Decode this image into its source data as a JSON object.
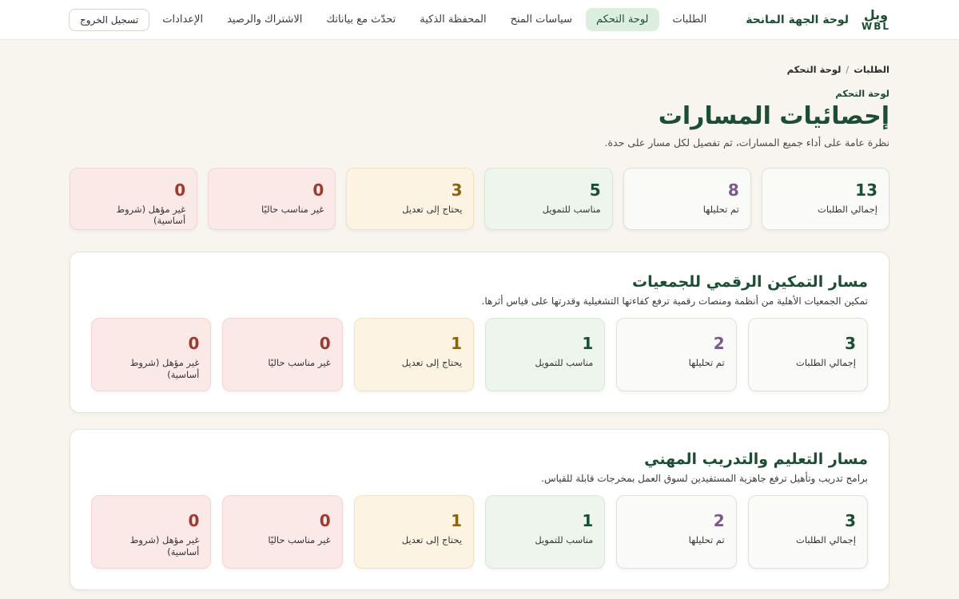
{
  "header": {
    "logo_ar": "وبل",
    "logo_en": "WBL",
    "brand_title": "لوحة الجهة المانحة",
    "nav": [
      {
        "label": "الطلبات",
        "active": false
      },
      {
        "label": "لوحة التحكم",
        "active": true
      },
      {
        "label": "سياسات المنح",
        "active": false
      },
      {
        "label": "المحفظة الذكية",
        "active": false
      },
      {
        "label": "تحدّث مع بياناتك",
        "active": false
      },
      {
        "label": "الاشتراك والرصيد",
        "active": false
      },
      {
        "label": "الإعدادات",
        "active": false
      }
    ],
    "logout_label": "تسجيل الخروج"
  },
  "breadcrumb": [
    "الطلبات",
    "لوحة التحكم"
  ],
  "page": {
    "eyebrow": "لوحة التحكم",
    "title": "إحصائيات المسارات",
    "subtitle": "نظرة عامة على أداء جميع المسارات، ثم تفصيل لكل مسار على حدة."
  },
  "overall_stats": [
    {
      "value": "13",
      "label": "إجمالي الطلبات",
      "tone": "neutral"
    },
    {
      "value": "8",
      "label": "تم تحليلها",
      "tone": "purple"
    },
    {
      "value": "5",
      "label": "مناسب للتمويل",
      "tone": "green"
    },
    {
      "value": "3",
      "label": "يحتاج إلى تعديل",
      "tone": "amber"
    },
    {
      "value": "0",
      "label": "غير مناسب حاليًا",
      "tone": "red"
    },
    {
      "value": "0",
      "label": "غير مؤهل (شروط أساسية)",
      "tone": "red"
    }
  ],
  "tracks": [
    {
      "title": "مسار التمكين الرقمي للجمعيات",
      "description": "تمكين الجمعيات الأهلية من أنظمة ومنصات رقمية ترفع كفاءتها التشغيلية وقدرتها على قياس أثرها.",
      "stats": [
        {
          "value": "3",
          "label": "إجمالي الطلبات",
          "tone": "neutral"
        },
        {
          "value": "2",
          "label": "تم تحليلها",
          "tone": "purple"
        },
        {
          "value": "1",
          "label": "مناسب للتمويل",
          "tone": "green"
        },
        {
          "value": "1",
          "label": "يحتاج إلى تعديل",
          "tone": "amber"
        },
        {
          "value": "0",
          "label": "غير مناسب حاليًا",
          "tone": "red"
        },
        {
          "value": "0",
          "label": "غير مؤهل (شروط أساسية)",
          "tone": "red"
        }
      ]
    },
    {
      "title": "مسار التعليم والتدريب المهني",
      "description": "برامج تدريب وتأهيل ترفع جاهزية المستفيدين لسوق العمل بمخرجات قابلة للقياس.",
      "stats": [
        {
          "value": "3",
          "label": "إجمالي الطلبات",
          "tone": "neutral"
        },
        {
          "value": "2",
          "label": "تم تحليلها",
          "tone": "purple"
        },
        {
          "value": "1",
          "label": "مناسب للتمويل",
          "tone": "green"
        },
        {
          "value": "1",
          "label": "يحتاج إلى تعديل",
          "tone": "amber"
        },
        {
          "value": "0",
          "label": "غير مناسب حاليًا",
          "tone": "red"
        },
        {
          "value": "0",
          "label": "غير مؤهل (شروط أساسية)",
          "tone": "red"
        }
      ]
    }
  ]
}
